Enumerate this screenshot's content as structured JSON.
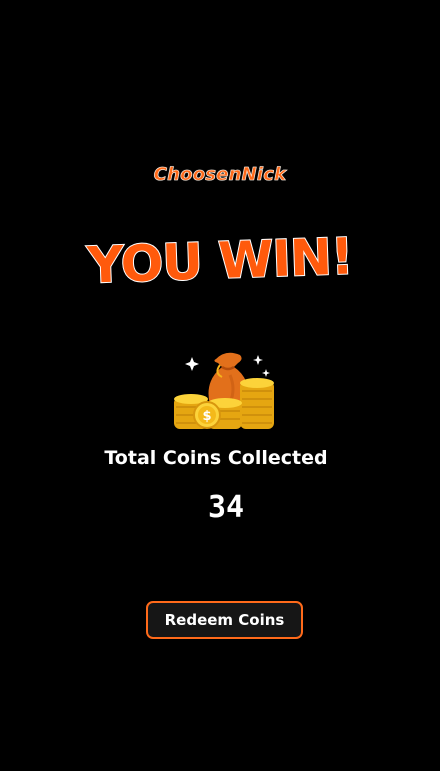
{
  "player": {
    "nickname": "ChoosenNick"
  },
  "result": {
    "title": "YOU WIN!"
  },
  "coins": {
    "label": "Total Coins Collected",
    "count": "34",
    "icon": "coin-bag-icon"
  },
  "actions": {
    "redeem_label": "Redeem Coins"
  },
  "colors": {
    "background": "#000000",
    "accent": "#ff6a1a",
    "title": "#ff5a0c",
    "coin": "#f7c21a",
    "text": "#ffffff"
  }
}
